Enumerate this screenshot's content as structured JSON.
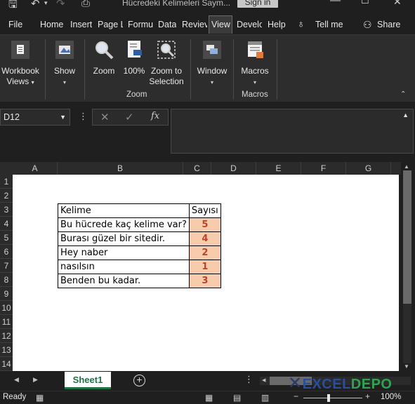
{
  "titlebar": {
    "doc_title": "Hücredeki Kelimeleri Saym...",
    "sign_in": "Sign in"
  },
  "menu": {
    "file": "File",
    "home": "Home",
    "insert": "Insert",
    "page_layout": "Page L",
    "formulas": "Formu",
    "data": "Data",
    "review": "Reviev",
    "view": "View",
    "developer": "Develc",
    "help": "Help",
    "tell_me": "Tell me",
    "share": "Share"
  },
  "ribbon": {
    "workbook_views": [
      "Workbook",
      "Views"
    ],
    "show": "Show",
    "zoom": "Zoom",
    "zoom100": "100%",
    "zoom_to_selection": [
      "Zoom to",
      "Selection"
    ],
    "window": "Window",
    "macros": "Macros",
    "group_zoom": "Zoom",
    "group_macros": "Macros"
  },
  "formula_bar": {
    "name_box": "D12",
    "fx": "fx"
  },
  "grid": {
    "columns": [
      "A",
      "B",
      "C",
      "D",
      "E",
      "F",
      "G"
    ],
    "rows": [
      "1",
      "2",
      "3",
      "4",
      "5",
      "6",
      "7",
      "8",
      "9",
      "10",
      "11",
      "12",
      "13",
      "14"
    ],
    "header": {
      "kelime": "Kelime",
      "sayisi": "Sayısı"
    },
    "table_rows": [
      {
        "text": "Bu hücrede kaç kelime var?",
        "count": "5"
      },
      {
        "text": "Burası güzel bir sitedir.",
        "count": "4"
      },
      {
        "text": "Hey naber",
        "count": "2"
      },
      {
        "text": "nasılsın",
        "count": "1"
      },
      {
        "text": "Benden bu kadar.",
        "count": "3"
      }
    ]
  },
  "tabs": {
    "sheet1": "Sheet1"
  },
  "watermark": {
    "a": "EXCEL",
    "b": "DEPO"
  },
  "status": {
    "ready": "Ready",
    "zoom": "100%"
  },
  "colors": {
    "accent_green": "#1e7145",
    "count_fill": "#f8cbad",
    "count_text": "#b5452b"
  }
}
